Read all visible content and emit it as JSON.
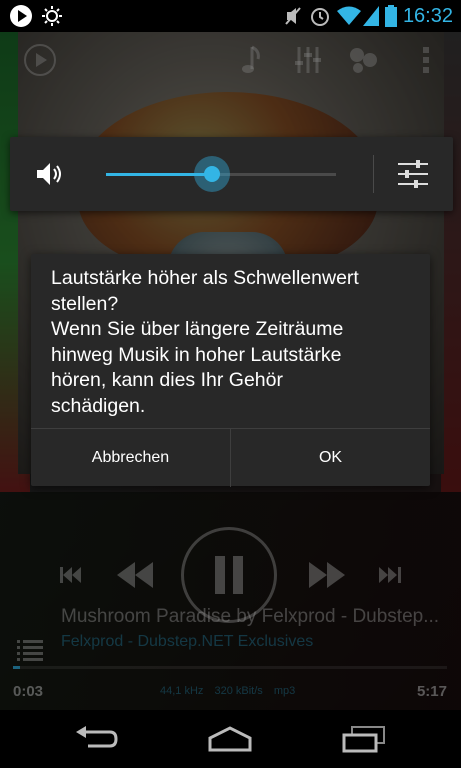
{
  "status_bar": {
    "time": "16:32",
    "icons": [
      "play-notification-icon",
      "brightness-icon",
      "mute-icon",
      "alarm-icon",
      "wifi-icon",
      "signal-icon",
      "battery-icon"
    ]
  },
  "player": {
    "track_title": "Mushroom Paradise by Felxprod - Dubstep...",
    "track_subtitle": "Felxprod - Dubstep.NET Exclusives",
    "time_elapsed": "0:03",
    "time_total": "5:17",
    "progress_fraction": 0.01,
    "info": {
      "sample_rate": "44,1 kHz",
      "bitrate": "320 kBit/s",
      "format": "mp3"
    }
  },
  "volume_panel": {
    "level_fraction": 0.46
  },
  "dialog": {
    "message_lines": [
      "Lautstärke höher als Schwellenwert",
      "stellen?",
      "Wenn Sie über längere Zeiträume",
      "hinweg Musik in hoher Lautstärke",
      "hören, kann dies Ihr Gehör",
      "schädigen."
    ],
    "cancel_label": "Abbrechen",
    "ok_label": "OK"
  },
  "colors": {
    "accent": "#33b5e5",
    "panel": "#282828"
  }
}
